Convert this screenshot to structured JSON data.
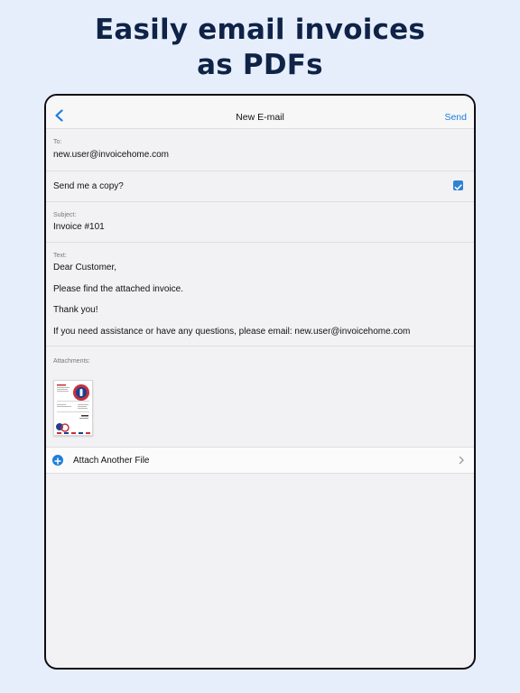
{
  "headline": {
    "line1": "Easily email invoices",
    "line2": "as PDFs"
  },
  "navbar": {
    "back_icon": "chevron-left-icon",
    "title": "New E-mail",
    "send_label": "Send"
  },
  "to": {
    "label": "To:",
    "value": "new.user@invoicehome.com"
  },
  "copy": {
    "label": "Send me a copy?",
    "checked": true
  },
  "subject": {
    "label": "Subject:",
    "value": "Invoice #101"
  },
  "text": {
    "label": "Text:",
    "line1": "Dear Customer,",
    "line2": "Please find the attached invoice.",
    "line3": "Thank you!",
    "line4": "If you need assistance or have any questions, please email: new.user@invoicehome.com"
  },
  "attachments": {
    "label": "Attachments:",
    "add_label": "Attach Another File",
    "add_icon": "plus-circle-icon",
    "chevron_icon": "chevron-right-icon"
  },
  "colors": {
    "accent": "#1d7ddc",
    "headline": "#0f2347",
    "background": "#e6eefb"
  }
}
